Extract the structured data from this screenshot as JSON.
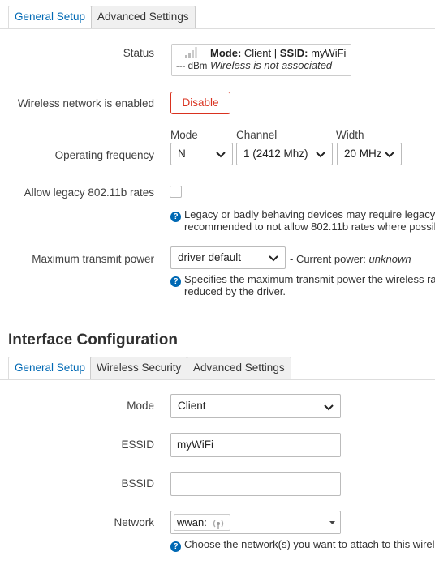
{
  "top_tabs": {
    "general_setup": "General Setup",
    "advanced_settings": "Advanced Settings"
  },
  "status": {
    "label": "Status",
    "dbm": "--- dBm",
    "mode_key": "Mode:",
    "mode_value": "Client",
    "separator": "|",
    "ssid_key": "SSID:",
    "ssid_value": "myWiFi",
    "association": "Wireless is not associated"
  },
  "wireless_enabled": {
    "label": "Wireless network is enabled",
    "button": "Disable"
  },
  "operating_frequency": {
    "label": "Operating frequency",
    "mode_label": "Mode",
    "mode_value": "N",
    "channel_label": "Channel",
    "channel_value": "1 (2412 Mhz)",
    "width_label": "Width",
    "width_value": "20 MHz"
  },
  "legacy_rates": {
    "label": "Allow legacy 802.11b rates",
    "checked": false,
    "help_line1": "Legacy or badly behaving devices may require legacy",
    "help_line2": "recommended to not allow 802.11b rates where possil"
  },
  "transmit_power": {
    "label": "Maximum transmit power",
    "value": "driver default",
    "current_prefix": "- Current power:",
    "current_value": "unknown",
    "help_line1": "Specifies the maximum transmit power the wireless ra",
    "help_line2": "reduced by the driver."
  },
  "interface_configuration": {
    "heading": "Interface Configuration",
    "tabs": {
      "general_setup": "General Setup",
      "wireless_security": "Wireless Security",
      "advanced_settings": "Advanced Settings"
    },
    "mode": {
      "label": "Mode",
      "value": "Client"
    },
    "essid": {
      "label": "ESSID",
      "value": "myWiFi"
    },
    "bssid": {
      "label": "BSSID",
      "value": ""
    },
    "network": {
      "label": "Network",
      "value": "wwan:",
      "help": "Choose the network(s) you want to attach to this wirele"
    }
  },
  "colors": {
    "accent": "#0069b4",
    "danger": "#d9321f"
  }
}
